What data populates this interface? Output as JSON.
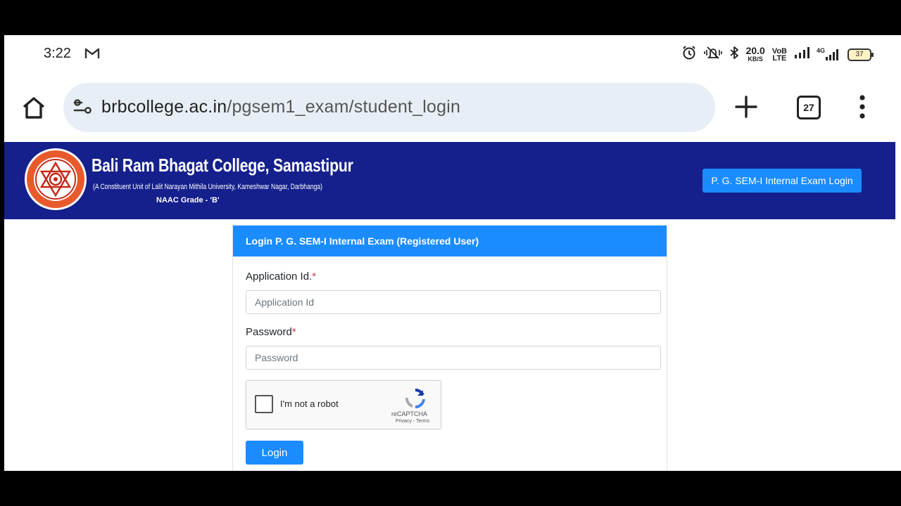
{
  "status_bar": {
    "time": "3:22",
    "net_speed_value": "20.0",
    "net_speed_unit": "KB/S",
    "volte_top": "VoB",
    "volte_bottom": "LTE",
    "network_type": "4G",
    "battery_level": "37",
    "icons": [
      "gmail-icon",
      "alarm-icon",
      "vibrate-icon",
      "bluetooth-icon",
      "signal-icon",
      "signal-4g-icon",
      "battery-icon"
    ]
  },
  "browser": {
    "url_host": "brbcollege.ac.in",
    "url_path": "/pgsem1_exam/student_login",
    "tab_count": "27",
    "icons": [
      "home-icon",
      "site-settings-icon",
      "new-tab-icon",
      "tabs-icon",
      "more-menu-icon"
    ]
  },
  "header": {
    "college_name": "Bali Ram Bhagat College, Samastipur",
    "college_subtitle": "(A Constituent Unit of Lalit Narayan Mithila University, Kameshwar Nagar, Darbhanga)",
    "naac_grade": "NAAC Grade - 'B'",
    "exam_login_button": "P. G. SEM-I Internal Exam Login",
    "brand_color": "#15208d"
  },
  "login_card": {
    "title": "Login P. G. SEM-I Internal Exam (Registered User)",
    "application_label": "Application Id.",
    "application_placeholder": "Application Id",
    "password_label": "Password",
    "password_placeholder": "Password",
    "required_mark": "*",
    "login_button": "Login",
    "accent_color": "#1a8cff"
  },
  "captcha": {
    "label": "I'm not a robot",
    "brand": "reCAPTCHA",
    "links": "Privacy - Terms"
  }
}
